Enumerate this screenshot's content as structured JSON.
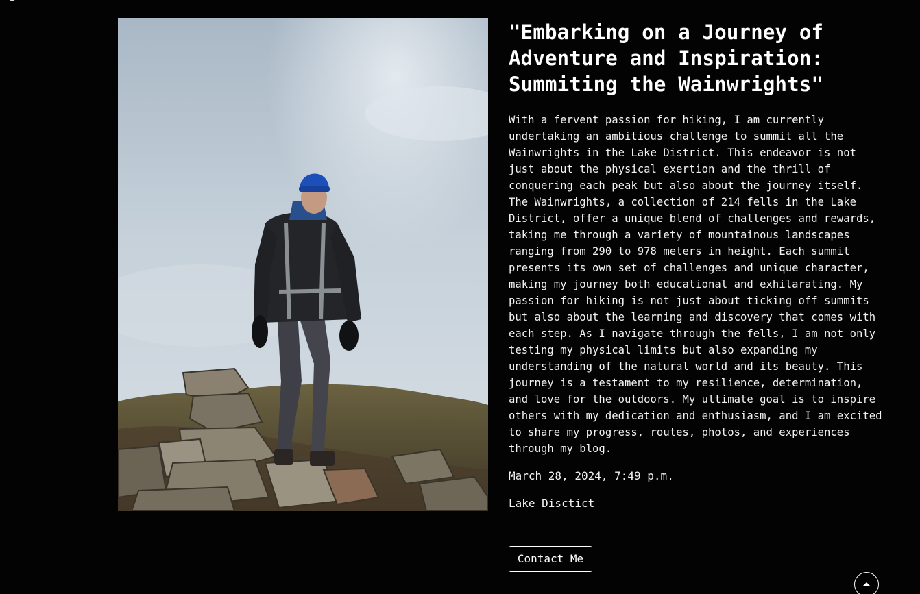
{
  "post": {
    "title": "\"Embarking on a Journey of Adventure and Inspiration: Summiting the Wainwrights\"",
    "body": "With a fervent passion for hiking, I am currently undertaking an ambitious challenge to summit all the Wainwrights in the Lake District. This endeavor is not just about the physical exertion and the thrill of conquering each peak but also about the journey itself. The Wainwrights, a collection of 214 fells in the Lake District, offer a unique blend of challenges and rewards, taking me through a variety of mountainous landscapes ranging from 290 to 978 meters in height. Each summit presents its own set of challenges and unique character, making my journey both educational and exhilarating. My passion for hiking is not just about ticking off summits but also about the learning and discovery that comes with each step. As I navigate through the fells, I am not only testing my physical limits but also expanding my understanding of the natural world and its beauty. This journey is a testament to my resilience, determination, and love for the outdoors. My ultimate goal is to inspire others with my dedication and enthusiasm, and I am excited to share my progress, routes, photos, and experiences through my blog.",
    "date": "March 28, 2024, 7:49 p.m.",
    "location": "Lake Disctict",
    "contact_label": "Contact Me"
  },
  "icons": {
    "scroll_top": "chevron-up-icon"
  },
  "colors": {
    "background": "#030303",
    "text": "#ffffff"
  }
}
